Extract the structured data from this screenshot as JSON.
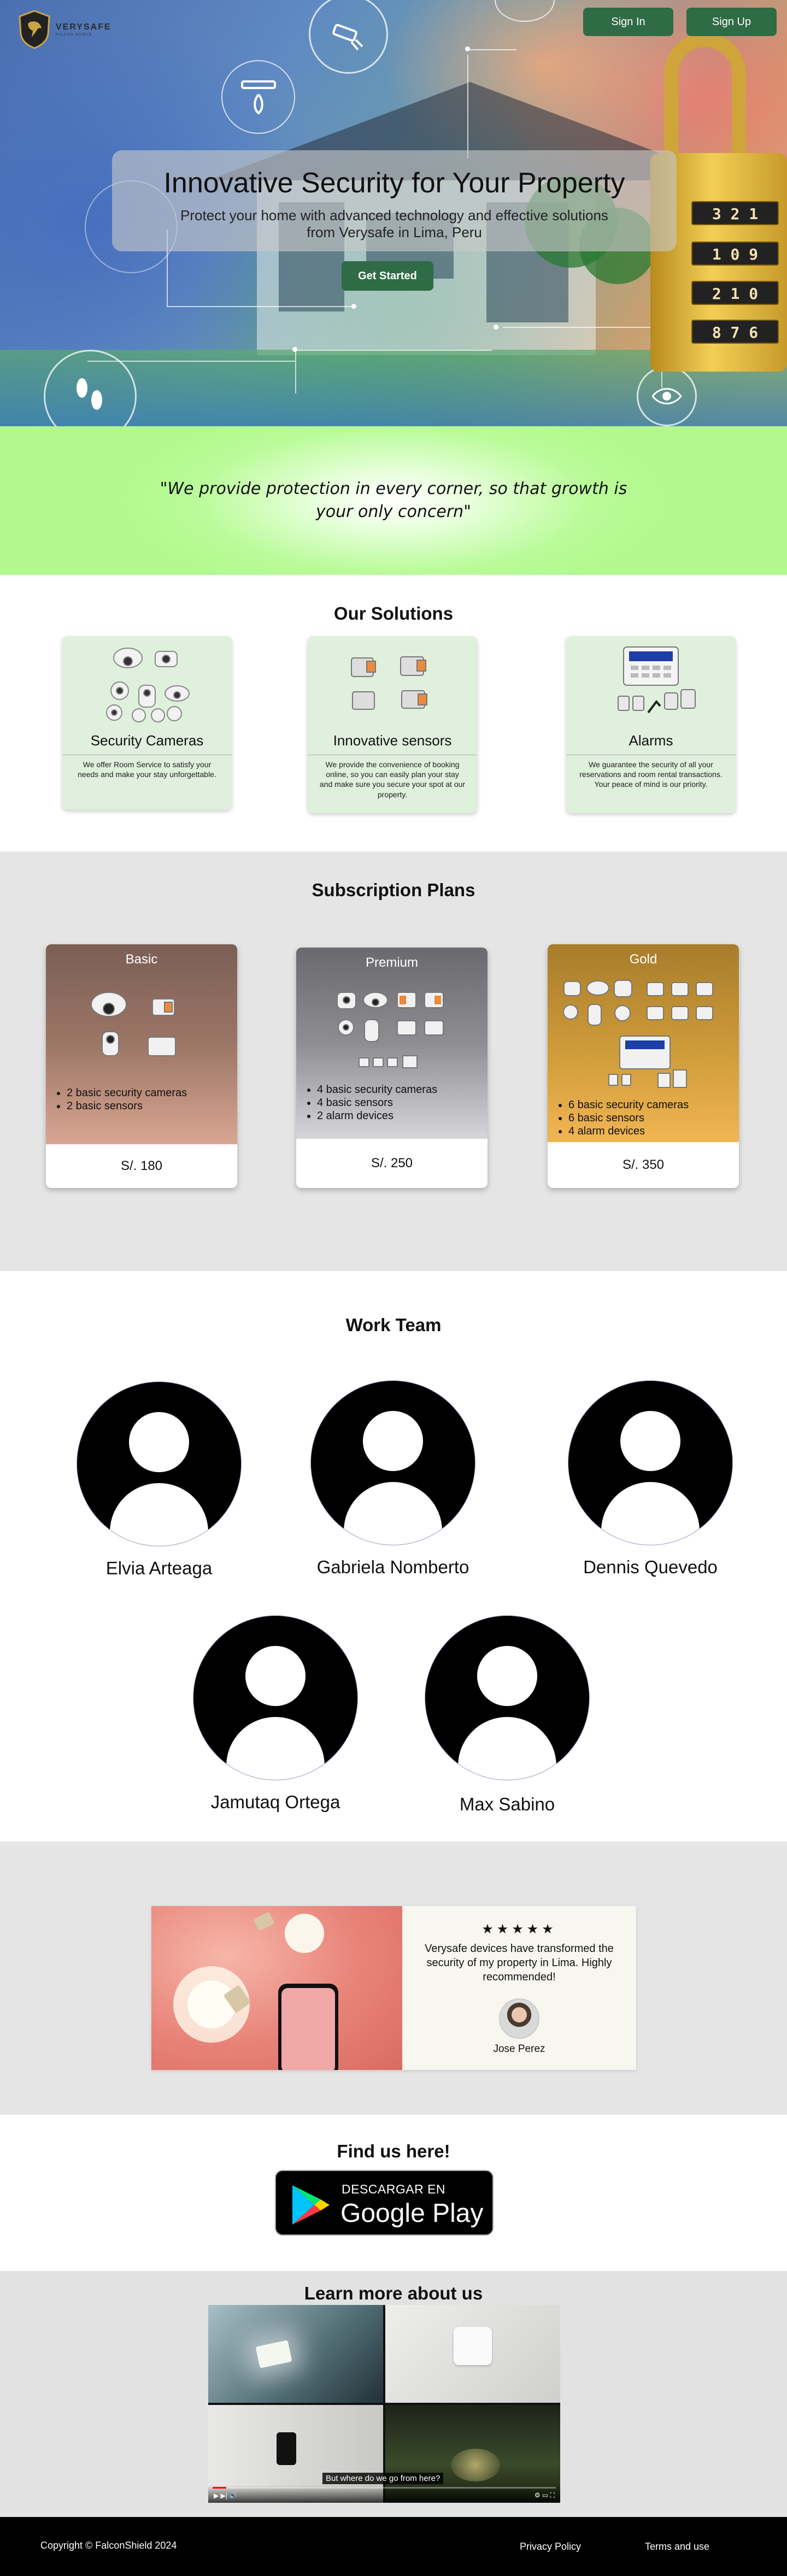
{
  "brand": {
    "logo_line1": "VERYSAFE",
    "logo_line2": "FALCON SHIELD",
    "primary_color": "#2f6b45"
  },
  "header": {
    "signin_label": "Sign In",
    "signup_label": "Sign Up"
  },
  "hero": {
    "title": "Innovative Security for Your Property",
    "subtitle": "Protect your home with advanced technology and effective solutions from Verysafe in Lima, Peru",
    "cta_label": "Get Started",
    "lock_digits": [
      "3 2 1",
      "1 0 9",
      "2 1 0",
      "8 7 6"
    ]
  },
  "quote": {
    "text": "\"We provide protection in every corner, so that growth is your only concern\""
  },
  "solutions": {
    "title": "Our Solutions",
    "items": [
      {
        "title": "Security Cameras",
        "text": "We offer Room Service to satisfy your needs and make your stay unforgettable."
      },
      {
        "title": "Innovative sensors",
        "text": "We provide the convenience of booking online, so you can easily plan your stay and make sure you secure your spot at our property."
      },
      {
        "title": "Alarms",
        "text": "We guarantee the security of all your reservations and room rental transactions. Your peace of mind is our priority."
      }
    ]
  },
  "plans": {
    "title": "Subscription Plans",
    "items": [
      {
        "name": "Basic",
        "features": [
          "2 basic security cameras",
          "2 basic sensors"
        ],
        "price": "S/. 180"
      },
      {
        "name": "Premium",
        "features": [
          "4 basic security cameras",
          "4 basic sensors",
          "2 alarm devices"
        ],
        "price": "S/. 250"
      },
      {
        "name": "Gold",
        "features": [
          "6 basic security cameras",
          "6 basic sensors",
          "4 alarm devices"
        ],
        "price": "S/. 350"
      }
    ]
  },
  "team": {
    "title": "Work Team",
    "members": [
      "Elvia Arteaga",
      "Gabriela Nomberto",
      "Dennis Quevedo",
      "Jamutaq Ortega",
      "Max Sabino"
    ]
  },
  "testimonial": {
    "stars": "★★★★★",
    "text": "Verysafe devices have transformed the security of my property in Lima. Highly recommended!",
    "author": "Jose Perez"
  },
  "findus": {
    "title": "Find us here!",
    "badge_small": "DESCARGAR EN",
    "badge_big": "Google Play"
  },
  "learn": {
    "title": "Learn more about us",
    "subtitle": "But where do we go from here?",
    "progress": 0.04
  },
  "footer": {
    "copyright": "Copyright © FalconShield 2024",
    "privacy": "Privacy Policy",
    "terms": "Terms and use"
  }
}
